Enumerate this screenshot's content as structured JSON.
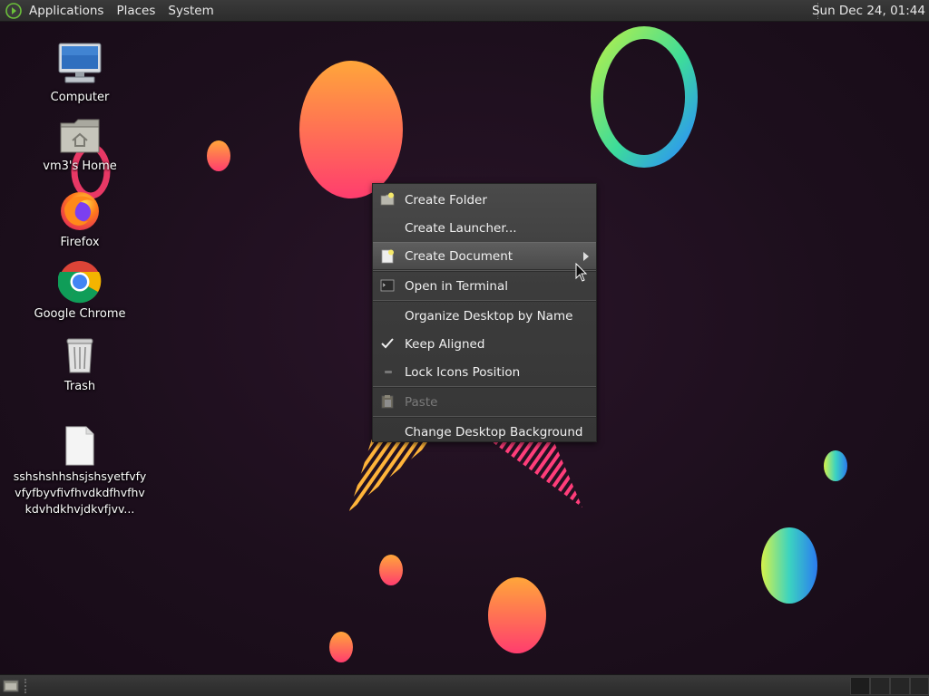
{
  "top_panel": {
    "menus": [
      "Applications",
      "Places",
      "System"
    ],
    "clock": "Sun Dec 24, 01:44"
  },
  "desktop_icons": [
    {
      "label": "Computer",
      "icon": "computer-icon"
    },
    {
      "label": "vm3's Home",
      "icon": "home-folder-icon"
    },
    {
      "label": "Firefox",
      "icon": "firefox-icon"
    },
    {
      "label": "Google Chrome",
      "icon": "chrome-icon"
    },
    {
      "label": "Trash",
      "icon": "trash-icon"
    },
    {
      "label": "sshshshhshsjshsyetfvfyvfyfbyvfivfhvdkdfhvfhvkdvhdkhvjdkvfjvv...",
      "icon": "text-file-icon"
    }
  ],
  "context_menu": {
    "items": [
      {
        "label": "Create Folder",
        "icon": "new-folder-icon"
      },
      {
        "label": "Create Launcher...",
        "icon": ""
      },
      {
        "label": "Create Document",
        "icon": "new-document-icon",
        "submenu": true,
        "highlighted": true
      },
      {
        "label": "Open in Terminal",
        "icon": "terminal-icon"
      },
      {
        "label": "Organize Desktop by Name",
        "icon": ""
      },
      {
        "label": "Keep Aligned",
        "icon": "checkmark-icon",
        "checked": true
      },
      {
        "label": "Lock Icons Position",
        "icon": "lock-toggle-icon",
        "checked": false
      },
      {
        "label": "Paste",
        "icon": "paste-icon",
        "disabled": true
      },
      {
        "label": "Change Desktop Background",
        "icon": ""
      }
    ]
  },
  "colors": {
    "panel": "#2e2e2e",
    "menu_bg": "#3e3e3e",
    "menu_highlight": "#555555",
    "desktop_bg": "#1e0f1e"
  }
}
